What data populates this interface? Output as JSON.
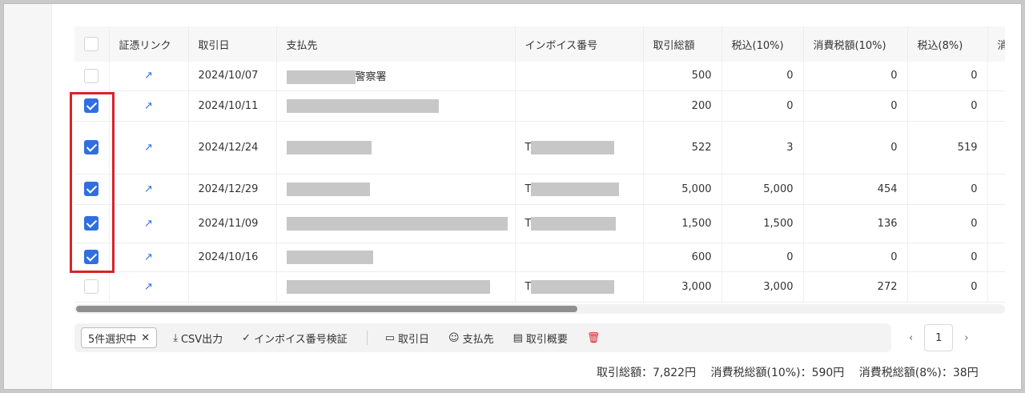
{
  "columns": [
    "",
    "証憑リンク",
    "取引日",
    "支払先",
    "インボイス番号",
    "取引総額",
    "税込(10%)",
    "消費税額(10%)",
    "税込(8%)",
    "消"
  ],
  "rows": [
    {
      "checked": false,
      "date": "2024/10/07",
      "payee_suffix": "警察署",
      "invoice_prefix": "",
      "total": "500",
      "incl10": "0",
      "tax10": "0",
      "incl8": "0"
    },
    {
      "checked": true,
      "date": "2024/10/11",
      "payee_suffix": "",
      "invoice_prefix": "",
      "total": "200",
      "incl10": "0",
      "tax10": "0",
      "incl8": "0"
    },
    {
      "checked": true,
      "date": "2024/12/24",
      "payee_suffix": "",
      "invoice_prefix": "T",
      "total": "522",
      "incl10": "3",
      "tax10": "0",
      "incl8": "519"
    },
    {
      "checked": true,
      "date": "2024/12/29",
      "payee_suffix": "",
      "invoice_prefix": "T",
      "total": "5,000",
      "incl10": "5,000",
      "tax10": "454",
      "incl8": "0"
    },
    {
      "checked": true,
      "date": "2024/11/09",
      "payee_suffix": "",
      "invoice_prefix": "T",
      "total": "1,500",
      "incl10": "1,500",
      "tax10": "136",
      "incl8": "0"
    },
    {
      "checked": true,
      "date": "2024/10/16",
      "payee_suffix": "",
      "invoice_prefix": "",
      "total": "600",
      "incl10": "0",
      "tax10": "0",
      "incl8": "0"
    },
    {
      "checked": false,
      "date": "",
      "payee_suffix": "",
      "invoice_prefix": "T",
      "total": "3,000",
      "incl10": "3,000",
      "tax10": "272",
      "incl8": "0"
    }
  ],
  "toolbar": {
    "selected_label": "5件選択中",
    "clear_icon": "close-icon",
    "csv_label": "CSV出力",
    "invoice_check_label": "インボイス番号検証",
    "date_label": "取引日",
    "payee_label": "支払先",
    "summary_label": "取引概要",
    "delete_icon": "trash-icon"
  },
  "pager": {
    "current_page": "1"
  },
  "totals": {
    "total": "取引総額：7,822円",
    "tax10": "消費税総額(10%)：590円",
    "tax8": "消費税総額(8%)：38円"
  },
  "colors": {
    "accent": "#2f6fe0",
    "highlight": "#d8232a"
  }
}
